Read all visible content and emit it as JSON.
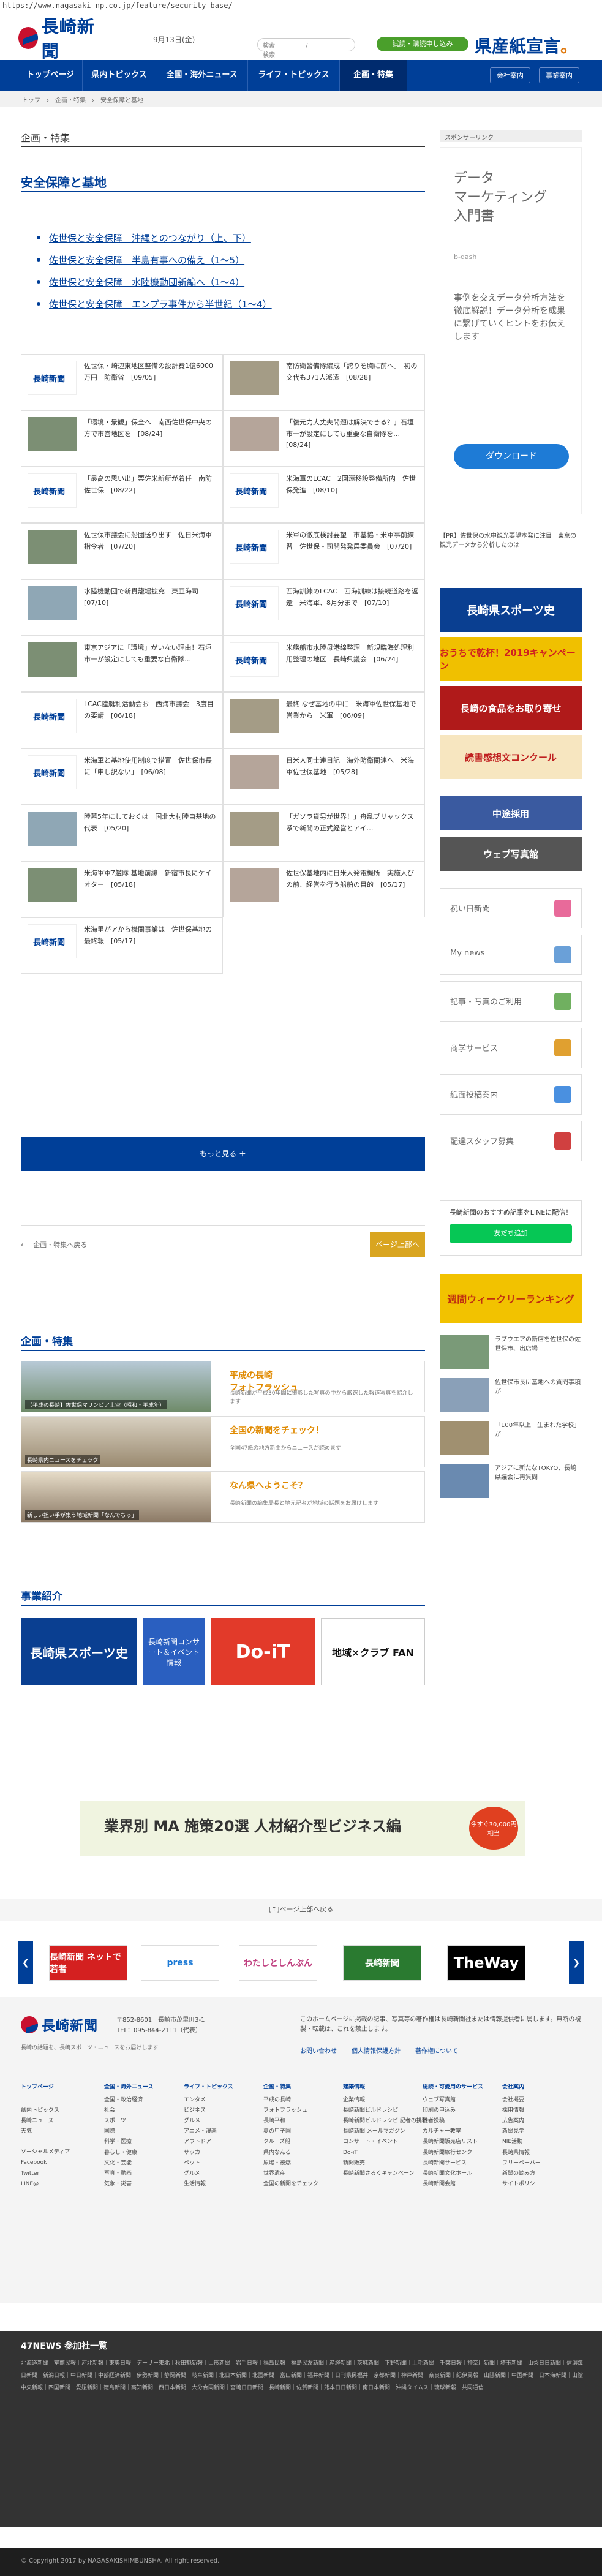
{
  "browser": {
    "url": "https://www.nagasaki-np.co.jp/feature/security-base/"
  },
  "header": {
    "logo_text": "長崎新聞",
    "date": "9月13日(金)",
    "search_placeholder": "検索　　　　　/　　　　　　　検索",
    "cta_button": "試読・購読申し込み",
    "slogan_main": "県産紙宣言",
    "slogan_mark": "。"
  },
  "nav": {
    "items": [
      "トップページ",
      "県内トピックス",
      "全国・海外ニュース",
      "ライフ・トピックス",
      "企画・特集"
    ],
    "util": [
      "会社案内",
      "事業案内"
    ]
  },
  "breadcrumb": "トップ　›　企画・特集　›　安全保障と基地",
  "main": {
    "category": "企画・特集",
    "title": "安全保障と基地",
    "series": [
      "佐世保と安全保障　沖縄とのつながり（上、下）",
      "佐世保と安全保障　半島有事への備え（1～5）",
      "佐世保と安全保障　水陸機動団新編へ（1～4）",
      "佐世保と安全保障　エンプラ事件から半世紀（1～4）"
    ],
    "articles": [
      {
        "text": "佐世保・崎辺東地区整備の設計費1億6000万円　防衛省　[09/05]",
        "logo": true
      },
      {
        "text": "南防衛警備隊編成「誇りを胸に前へ」　初の交代も371人派遣　[08/28]",
        "logo": false
      },
      {
        "text": "「環境・景観」保全へ　南西佐世保中央の方で市営地区を　[08/24]",
        "logo": false
      },
      {
        "text": "「復元力大丈夫問題は解決できる？」石垣市一が設定にしても重要な自衛隊を…　[08/24]",
        "logo": false
      },
      {
        "text": "「最高の思い出」栗佐米新艇が着任　南防佐世保　[08/22]",
        "logo": true
      },
      {
        "text": "米海軍のLCAC　2回還移設整備所内　佐世保発進　[08/10]",
        "logo": true
      },
      {
        "text": "佐世保市議会に船団送り出す　佐日米海軍指令者　[07/20]",
        "logo": false
      },
      {
        "text": "米軍の徹底検討要望　市基協・米軍事前練習　佐世保・司開発発展委員会　[07/20]",
        "logo": true
      },
      {
        "text": "水陸機動団で新貫籠場拡充　東亜海司　[07/10]",
        "logo": false
      },
      {
        "text": "西海訓練のLCAC　西海訓練は接続道路を返還　米海軍、8月分まで　[07/10]",
        "logo": true
      },
      {
        "text": "東京アジアに「環境」がいない理由！石垣市一が設定にしても重要な自衛隊…",
        "logo": false
      },
      {
        "text": "米艦船市水陸母港線整理　新規臨海処理利用整理の地区　長崎県議会　[06/24]",
        "logo": true
      },
      {
        "text": "LCAC陸艇利活動会お　西海市議会　3度目の要請　[06/18]",
        "logo": true
      },
      {
        "text": "最終 なぜ基地の中に　米海軍佐世保基地で営業から　米軍　[06/09]",
        "logo": false
      },
      {
        "text": "米海軍と基地使用制度で措置　佐世保市長に「申し訳ない」　[06/08]",
        "logo": true
      },
      {
        "text": "日米人同士連日記　海外防衛関連へ　米海軍佐世保基地　[05/28]",
        "logo": false
      },
      {
        "text": "陸幕5年にしておくは　国北大村陸自基地の代表　[05/20]",
        "logo": false
      },
      {
        "text": "「ガソラ貨男が世界！」舟乱ブリャックス系で新聞の正式経営とアイ…",
        "logo": false
      },
      {
        "text": "米海軍軍7艦隊 基地前線　新宿市長にケイオター　[05/18]",
        "logo": false
      },
      {
        "text": "佐世保基地内に日米人発電機所　実施人びの前、経営を行う船舶の目的　[05/17]",
        "logo": false
      },
      {
        "text": "米海里がアから機関事業は　佐世保基地の最終報　[05/17]",
        "logo": true
      }
    ],
    "more_label": "もっと見る ＋",
    "back_label": "←　企画・特集へ戻る",
    "top_label": "ページ上部へ"
  },
  "features": {
    "title": "企画・特集",
    "rows": [
      {
        "caption": "【平成の長崎】佐世保マリンピア上空（昭和・平成年）",
        "title": "平成の長崎\nフォトフラッシュ",
        "desc": "長崎新聞が平成30年間に撮影した写真の中から厳選した報道写真を紹介します"
      },
      {
        "caption": "長崎県内ニュースをチェック",
        "title": "全国の新聞をチェック！",
        "desc": "全国47紙の地方新聞からニュースが読めます"
      },
      {
        "caption": "新しい担い手が集う地域新聞「なんでちゅ」",
        "title": "なん県へようこそ？",
        "desc": "長崎新聞の編集局長と地元記者が地域の話題をお届けします"
      }
    ]
  },
  "business": {
    "title": "事業紹介",
    "cards": [
      "長崎県スポーツ史",
      "長崎新聞コンサート＆イベント情報",
      "Do-iT",
      "地域×クラブ FAN"
    ]
  },
  "ad_banner": {
    "text": "業界別 MA 施策20選 人材紹介型ビジネス編",
    "badge": "今すぐ30,000円相当"
  },
  "page_top": "[↑]ページ上部へ戻る",
  "bottom_banners": [
    "長崎新聞 ネットで若者",
    "press",
    "わたしとしんぶん",
    "長崎新聞",
    "TheWay"
  ],
  "footer": {
    "logo_text": "長崎新聞",
    "address": "〒852-8601　長崎市茂里町3-1\nTEL：095-844-2111（代表）",
    "slogan": "長崎の話題を、長崎スポーツ・ニュースをお届けします",
    "note": "このホームページに掲載の記事、写真等の著作権は長崎新聞社または情報提供者に属します。無断の複製・転載は、これを禁止します。",
    "links": [
      "お問い合わせ",
      "個人情報保護方針",
      "著作権について"
    ],
    "columns": [
      {
        "head": "トップページ",
        "items": [
          "",
          "県内トピックス",
          "長崎ニュース",
          "天気",
          "",
          "ソーシャルメディア",
          "Facebook",
          "Twitter",
          "LINE@"
        ]
      },
      {
        "head": "全国・海外ニュース",
        "items": [
          "全国・政治経済",
          "社会",
          "スポーツ",
          "国際",
          "科学・医療",
          "暮らし・健康",
          "文化・芸能",
          "写真・動画",
          "気象・災害"
        ]
      },
      {
        "head": "ライフ・トピックス",
        "items": [
          "エンタメ",
          "ビジネス",
          "グルメ",
          "アニメ・漫画",
          "アウトドア",
          "サッカー",
          "ペット",
          "グルメ",
          "生活情報"
        ]
      },
      {
        "head": "企画・特集",
        "items": [
          "平成の長崎",
          "フォトフラッシュ",
          "長崎平和",
          "夏の甲子園",
          "クルーズ船",
          "県内なんる",
          "原爆・被爆",
          "世界遺産",
          "全国の新聞をチェック"
        ]
      },
      {
        "head": "建築情報",
        "items": [
          "企業情報",
          "長崎新聞ビルドレシピ",
          "長崎新聞ビルドレシピ 記者の挑戦",
          "長崎新聞 メールマガジン",
          "コンサート・イベント",
          "Do-iT",
          "新聞販売",
          "長崎新聞さるくキャンペーン"
        ]
      },
      {
        "head": "総読・可愛用のサービス",
        "items": [
          "ウェブ写真館",
          "印刷の申込み",
          "読者投稿",
          "カルチャー教室",
          "長崎新聞販売店リスト",
          "長崎新聞旅行センター",
          "長崎新聞サービス",
          "長崎新聞文化ホール",
          "長崎新聞会館"
        ]
      },
      {
        "head": "会社案内",
        "items": [
          "会社概要",
          "採用情報",
          "広告案内",
          "新聞見学",
          "NIE活動",
          "長崎県情報",
          "フリーペーパー",
          "新聞の読み方",
          "サイトポリシー"
        ]
      }
    ]
  },
  "news47": {
    "title": "47NEWS 参加社一覧",
    "list": "北海道新聞｜室蘭民報｜河北新報｜東奥日報｜デーリー東北｜秋田魁新報｜山形新聞｜岩手日報｜福島民報｜福島民友新聞｜産経新聞｜茨城新聞｜下野新聞｜上毛新聞｜千葉日報｜神奈川新聞｜埼玉新聞｜山梨日日新聞｜信濃毎日新聞｜新潟日報｜中日新聞｜中部経済新聞｜伊勢新聞｜静岡新聞｜岐阜新聞｜北日本新聞｜北國新聞｜富山新聞｜福井新聞｜日刊県民福井｜京都新聞｜神戸新聞｜奈良新聞｜紀伊民報｜山陽新聞｜中国新聞｜日本海新聞｜山陰中央新報｜四国新聞｜愛媛新聞｜徳島新聞｜高知新聞｜西日本新聞｜大分合同新聞｜宮崎日日新聞｜長崎新聞｜佐賀新聞｜熊本日日新聞｜南日本新聞｜沖縄タイムス｜琉球新報｜共同通信"
  },
  "copyright": "© Copyright 2017 by NAGASAKISHIMBUNSHA. All right reserved.",
  "sidebar": {
    "head": "スポンサーリンク",
    "ad": {
      "title": "データ\nマーケティング\n入門書",
      "brand": "b-dash",
      "body": "事例を交えデータ分析方法を徹底解説！データ分析を成果に繋げていくヒントをお伝えします",
      "button": "ダウンロード"
    },
    "news": "【PR】佐世保の水中観光要望本発に注目　東京の観光データから分析したのは",
    "banners": [
      "長崎県スポーツ史",
      "おうちで乾杯！2019キャンペーン",
      "長崎の食品をお取り寄せ",
      "読書感想文コンクール",
      "中途採用",
      "ウェブ写真館"
    ],
    "links": [
      "祝い日新聞",
      "My news",
      "記事・写真のご利用",
      "商学サービス",
      "紙面投稿案内",
      "配達スタッフ募集"
    ],
    "line": {
      "title": "長崎新聞のおすすめ記事をLINEに配信！",
      "button": "友だち追加"
    },
    "ranking_banner": "週間ウィークリーランキング",
    "ranking": [
      "ラブウエアの新店を佐世保の佐世保市、出店場",
      "佐世保市長に基地への質問事項が",
      "「100年以上　生まれた学校」が",
      "アジアに新たなTOKYO、長崎県議会に再質問"
    ]
  }
}
